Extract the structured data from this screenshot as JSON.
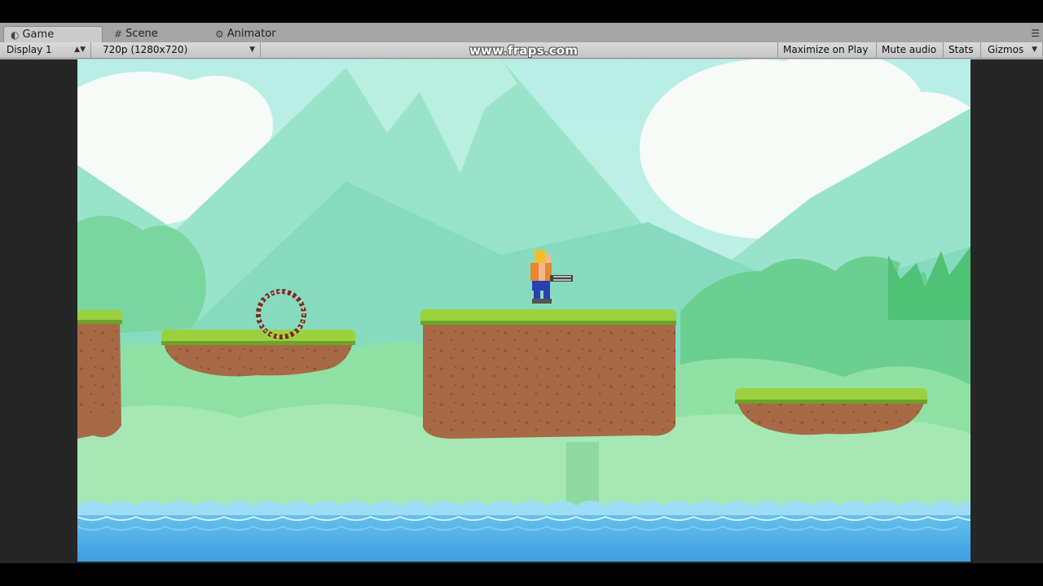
{
  "tabs": [
    {
      "label": "Game",
      "icon": "game-controller-icon",
      "active": true
    },
    {
      "label": "Scene",
      "icon": "grid-hash-icon",
      "active": false
    },
    {
      "label": "Animator",
      "icon": "animator-icon",
      "active": false
    }
  ],
  "toolbar": {
    "display_select": "Display 1",
    "resolution_select": "720p (1280x720)",
    "maximize_label": "Maximize on Play",
    "mute_label": "Mute audio",
    "stats_label": "Stats",
    "gizmos_label": "Gizmos"
  },
  "overlay": {
    "watermark": "www.fraps.com"
  },
  "colors": {
    "sky": "#bff0e4",
    "mountain": "#86dbbf",
    "foliage": "#6fd49c",
    "grass": "#9bd13f",
    "dirt": "#a86a46",
    "water": "#4fb4e6"
  }
}
